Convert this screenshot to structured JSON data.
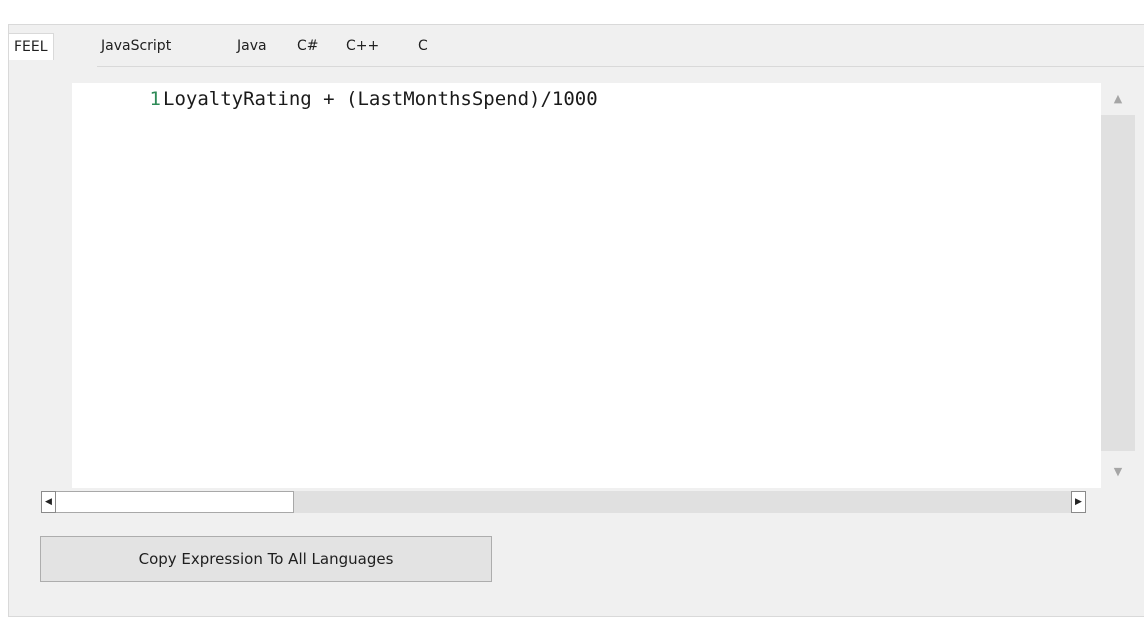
{
  "tabs": [
    {
      "label": "FEEL",
      "active": true
    },
    {
      "label": "JavaScript",
      "active": false
    },
    {
      "label": "Java",
      "active": false
    },
    {
      "label": "C#",
      "active": false
    },
    {
      "label": "C++",
      "active": false
    },
    {
      "label": "C",
      "active": false
    }
  ],
  "editor": {
    "lines": [
      {
        "number": "1",
        "text": "LoyaltyRating + (LastMonthsSpend)/1000"
      }
    ]
  },
  "scrollbars": {
    "up_arrow": "▲",
    "down_arrow": "▼",
    "left_arrow": "◀",
    "right_arrow": "▶"
  },
  "buttons": {
    "copy_expression_label": "Copy Expression To All Languages"
  },
  "colors": {
    "panel_background": "#f0f0f0",
    "editor_background": "#ffffff",
    "line_number": "#2e8b57",
    "code_text": "#1a1a1a"
  }
}
